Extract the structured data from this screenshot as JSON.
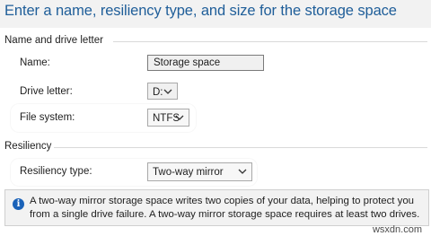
{
  "dialog": {
    "heading": "Enter a name, resiliency type, and size for the storage space"
  },
  "name_section": {
    "title": "Name and drive letter",
    "name_label": "Name:",
    "name_value": "Storage space",
    "drive_letter_label": "Drive letter:",
    "drive_letter_value": "D:",
    "file_system_label": "File system:",
    "file_system_value": "NTFS"
  },
  "resiliency_section": {
    "title": "Resiliency",
    "type_label": "Resiliency type:",
    "type_value": "Two-way mirror",
    "info_text": "A two-way mirror storage space writes two copies of your data, helping to protect you from a single drive failure. A two-way mirror storage space requires at least two drives."
  },
  "watermark": "wsxdn.com",
  "colors": {
    "heading": "#1f5e99",
    "info_icon": "#1a62b8",
    "panel_bg": "#f2f2f2"
  },
  "icons": {
    "chevron": "chevron-down-icon",
    "info": "info-icon"
  }
}
